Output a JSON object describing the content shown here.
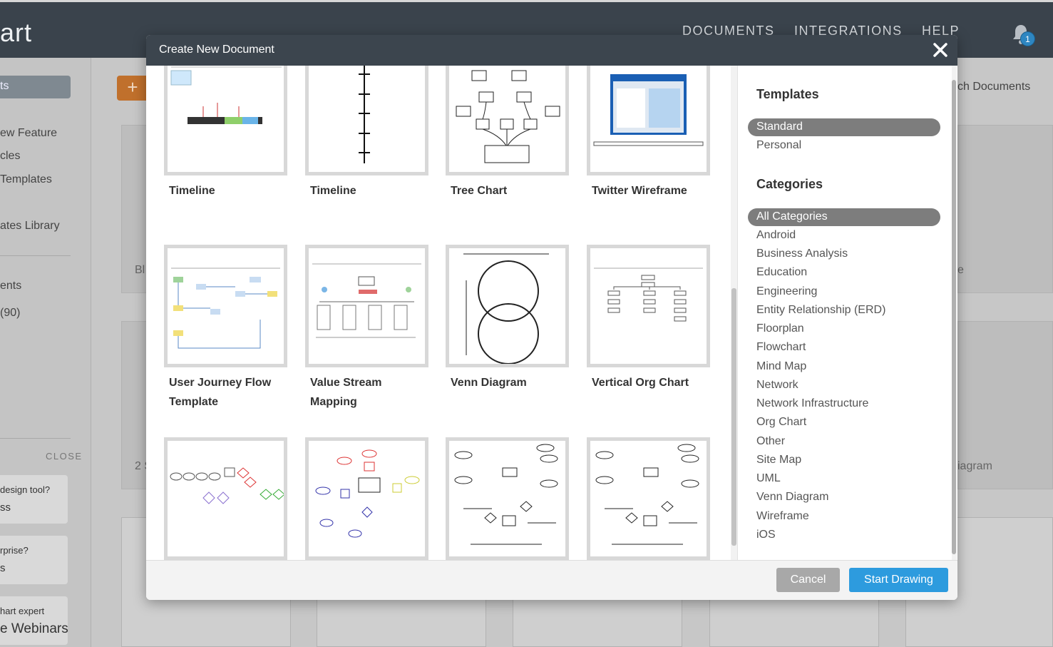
{
  "app": {
    "brand_partial": "art"
  },
  "topnav": {
    "documents": "DOCUMENTS",
    "integrations": "INTEGRATIONS",
    "help": "HELP",
    "notification_count": "1"
  },
  "sidebar": {
    "selected_partial": "ts",
    "items": [
      "ew Feature",
      "cles",
      "Templates",
      "ates Library",
      "ents",
      "(90)"
    ],
    "close_label": "CLOSE",
    "promos": [
      {
        "line1": "design tool?",
        "line2": "ss"
      },
      {
        "line1": "rprise?",
        "line2": "s"
      },
      {
        "line1": "hart expert",
        "line2": "e Webinars"
      }
    ]
  },
  "main": {
    "search_partial": "ch Documents",
    "bg_texts": [
      "Bl",
      "2 S",
      "e",
      "iagram"
    ]
  },
  "modal": {
    "title": "Create New Document",
    "tiles": [
      {
        "label": "Timeline"
      },
      {
        "label": "Timeline"
      },
      {
        "label": "Tree Chart"
      },
      {
        "label": "Twitter Wireframe"
      },
      {
        "label": "User Journey Flow Template"
      },
      {
        "label": "Value Stream Mapping"
      },
      {
        "label": "Venn Diagram"
      },
      {
        "label": "Vertical Org Chart"
      },
      {
        "label": ""
      },
      {
        "label": ""
      },
      {
        "label": ""
      },
      {
        "label": ""
      }
    ],
    "panel": {
      "templates_heading": "Templates",
      "template_types": [
        "Standard",
        "Personal"
      ],
      "categories_heading": "Categories",
      "categories": [
        "All Categories",
        "Android",
        "Business Analysis",
        "Education",
        "Engineering",
        "Entity Relationship (ERD)",
        "Floorplan",
        "Flowchart",
        "Mind Map",
        "Network",
        "Network Infrastructure",
        "Org Chart",
        "Other",
        "Site Map",
        "UML",
        "Venn Diagram",
        "Wireframe",
        "iOS"
      ]
    },
    "cancel_label": "Cancel",
    "start_label": "Start Drawing"
  },
  "colors": {
    "header": "#3c454e",
    "primary": "#2d9bde",
    "chip": "#7d7d7d",
    "plus": "#c0702c"
  }
}
